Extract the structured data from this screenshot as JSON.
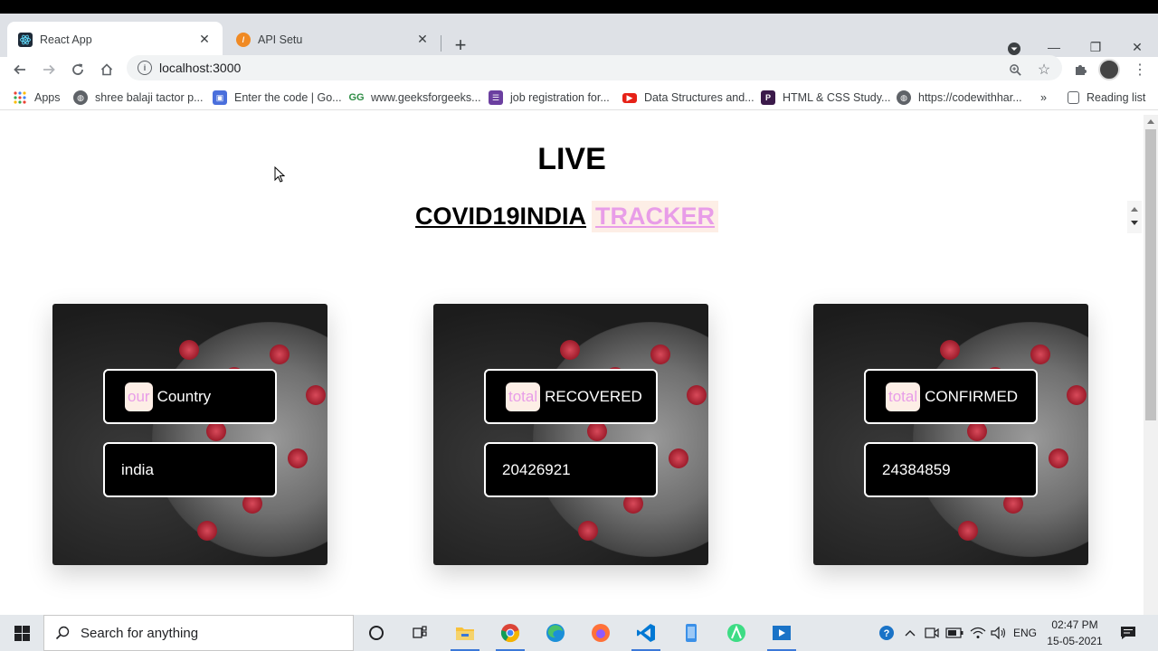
{
  "browser": {
    "tabs": [
      {
        "title": "React App",
        "active": true,
        "icon": "react-icon",
        "icon_color": "#1e2a38"
      },
      {
        "title": "API Setu",
        "active": false,
        "icon": "api-setu-icon",
        "icon_color": "#f08a24"
      }
    ],
    "close_glyph": "✕",
    "newtab_glyph": "+",
    "url": "localhost:3000",
    "window_controls": {
      "minimize": "—",
      "restore": "❐",
      "close": "✕"
    }
  },
  "bookmarks": {
    "apps_label": "Apps",
    "items": [
      {
        "label": "shree balaji tactor p...",
        "icon": "globe-icon",
        "color": "#5f6368"
      },
      {
        "label": "Enter the code | Go...",
        "icon": "google-classroom-icon",
        "color": "#4a6fdc"
      },
      {
        "label": "www.geeksforgeeks...",
        "icon": "geeksforgeeks-icon",
        "color": "#2f8d46"
      },
      {
        "label": "job registration for...",
        "icon": "google-forms-icon",
        "color": "#6b3fa0"
      },
      {
        "label": "Data Structures and...",
        "icon": "youtube-icon",
        "color": "#e62117"
      },
      {
        "label": "HTML & CSS Study...",
        "icon": "pinterest-p-icon",
        "color": "#3b1a4a"
      },
      {
        "label": "https://codewithhar...",
        "icon": "globe-icon",
        "color": "#5f6368"
      }
    ],
    "overflow": "»",
    "reading_list": "Reading list"
  },
  "page": {
    "title": "LIVE",
    "headline_main": "COVID19INDIA",
    "headline_accent": "TRACKER",
    "accent_color": "#e89de8",
    "cards": [
      {
        "tag": "our",
        "label": "Country",
        "value": "india"
      },
      {
        "tag": "total",
        "label": "RECOVERED",
        "value": "20426921"
      },
      {
        "tag": "total",
        "label": "CONFIRMED",
        "value": "24384859"
      }
    ]
  },
  "taskbar": {
    "search_placeholder": "Search for anything",
    "apps": [
      "cortana-icon",
      "task-view-icon",
      "file-explorer-icon",
      "chrome-icon",
      "edge-icon",
      "firefox-icon",
      "vscode-icon",
      "phone-link-icon",
      "android-studio-icon",
      "media-player-icon"
    ],
    "language": "ENG",
    "time": "02:47 PM",
    "date": "15-05-2021"
  }
}
